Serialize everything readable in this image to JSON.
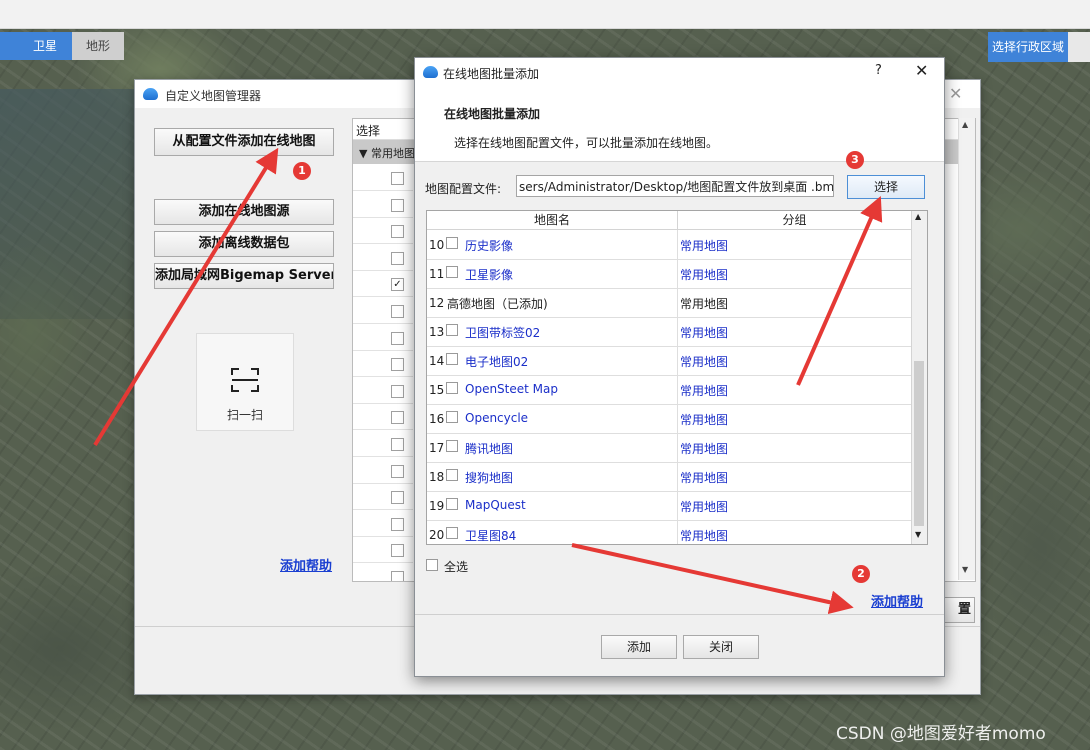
{
  "map": {
    "tabs": [
      "卫星",
      "地形"
    ],
    "region_select": "选择行政区域",
    "watermark": "CSDN @地图爱好者momo"
  },
  "manager": {
    "title": "自定义地图管理器",
    "buttons": {
      "add_from_config": "从配置文件添加在线地图",
      "add_online_source": "添加在线地图源",
      "add_offline_package": "添加离线数据包",
      "add_lan_server": "添加局域网Bigemap Server"
    },
    "scan_label": "扫一扫",
    "help_link": "添加帮助",
    "list_header": "选择",
    "group_label": "常用地图",
    "partial_button": "置"
  },
  "batch": {
    "title": "在线地图批量添加",
    "help": "?",
    "close": "✕",
    "heading": "在线地图批量添加",
    "description": "选择在线地图配置文件，可以批量添加在线地图。",
    "config_label": "地图配置文件:",
    "config_path": "sers/Administrator/Desktop/地图配置文件放到桌面 .bmms",
    "select_button": "选择",
    "columns": {
      "name": "地图名",
      "group": "分组"
    },
    "rows": [
      {
        "num": "10",
        "name": "历史影像",
        "group": "常用地图",
        "added": false
      },
      {
        "num": "11",
        "name": "卫星影像",
        "group": "常用地图",
        "added": false
      },
      {
        "num": "12",
        "name": "高德地图（已添加)",
        "group": "常用地图",
        "added": true
      },
      {
        "num": "13",
        "name": "卫图带标签02",
        "group": "常用地图",
        "added": false
      },
      {
        "num": "14",
        "name": "电子地图02",
        "group": "常用地图",
        "added": false
      },
      {
        "num": "15",
        "name": "OpenSteet Map",
        "group": "常用地图",
        "added": false
      },
      {
        "num": "16",
        "name": "Opencycle",
        "group": "常用地图",
        "added": false
      },
      {
        "num": "17",
        "name": "腾讯地图",
        "group": "常用地图",
        "added": false
      },
      {
        "num": "18",
        "name": "搜狗地图",
        "group": "常用地图",
        "added": false
      },
      {
        "num": "19",
        "name": "MapQuest",
        "group": "常用地图",
        "added": false
      },
      {
        "num": "20",
        "name": "卫星图84",
        "group": "常用地图",
        "added": false
      }
    ],
    "select_all": "全选",
    "help_link": "添加帮助",
    "add_button": "添加",
    "close_button": "关闭"
  },
  "annotations": {
    "badges": [
      "1",
      "2",
      "3"
    ],
    "accent_color": "#e53935"
  }
}
